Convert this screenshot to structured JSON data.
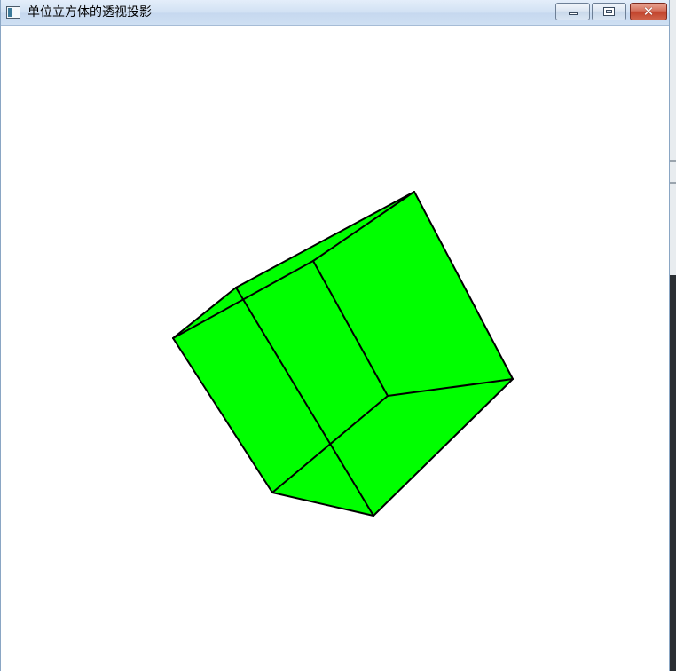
{
  "window": {
    "title": "单位立方体的透视投影",
    "icon": "app-window-icon",
    "controls": {
      "minimize_icon": "minimize-icon",
      "maximize_icon": "maximize-icon",
      "close_icon": "close-icon",
      "close_glyph": "✕"
    }
  },
  "scene": {
    "object": "unit-cube-perspective-projection",
    "fill_color": "#00ff00",
    "edge_color": "#000000",
    "background_color": "#ffffff"
  },
  "colors": {
    "titlebar": "#d3e2f4",
    "close_button": "#c2442d"
  }
}
